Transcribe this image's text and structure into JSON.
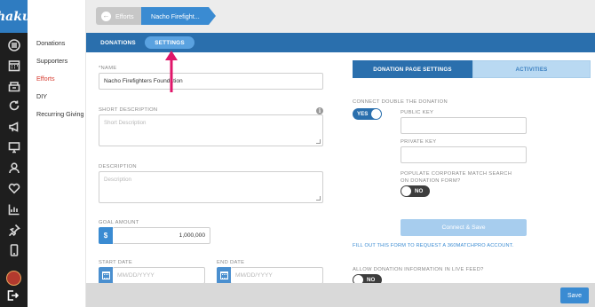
{
  "brand": {
    "logo_text": "haku"
  },
  "rail": {
    "icons": [
      "dashboard-icon",
      "calendar-icon",
      "inbox-icon",
      "refresh-icon",
      "megaphone-icon",
      "monitor-icon",
      "users-icon",
      "heart-icon",
      "bar-chart-icon",
      "pin-icon",
      "mobile-icon"
    ]
  },
  "subnav": {
    "items": [
      {
        "label": "Donations",
        "active": false
      },
      {
        "label": "Supporters",
        "active": false
      },
      {
        "label": "Efforts",
        "active": true
      },
      {
        "label": "DIY",
        "active": false
      },
      {
        "label": "Recurring Giving",
        "active": false
      }
    ]
  },
  "breadcrumb": {
    "back_label": "Efforts",
    "current_label": "Nacho Firefight..."
  },
  "tabs": {
    "donations": "DONATIONS",
    "settings": "SETTINGS"
  },
  "form": {
    "name_label": "*NAME",
    "name_value": "Nacho Firefighters Foundation",
    "short_desc_label": "SHORT DESCRIPTION",
    "short_desc_placeholder": "Short Description",
    "desc_label": "DESCRIPTION",
    "desc_placeholder": "Description",
    "goal_label": "GOAL AMOUNT",
    "goal_prefix": "$",
    "goal_value": "1,000,000",
    "start_label": "START DATE",
    "start_placeholder": "MM/DD/YYYY",
    "end_label": "END DATE",
    "end_placeholder": "MM/DD/YYYY"
  },
  "right": {
    "tab_page_settings": "DONATION PAGE SETTINGS",
    "tab_activities": "ACTIVITIES",
    "connect_label": "CONNECT DOUBLE THE DONATION",
    "connect_toggle": "YES",
    "public_key_label": "PUBLIC KEY",
    "private_key_label": "PRIVATE KEY",
    "populate_label_1": "POPULATE CORPORATE MATCH SEARCH",
    "populate_label_2": "ON DONATION FORM?",
    "populate_toggle": "NO",
    "connect_save": "Connect & Save",
    "request_link": "FILL OUT THIS FORM TO REQUEST A 360MATCHPRO ACCOUNT.",
    "live_feed_label": "ALLOW DONATION INFORMATION IN LIVE FEED?",
    "live_feed_toggle": "NO"
  },
  "footer": {
    "save_label": "Save"
  },
  "colors": {
    "primary": "#2a6fad",
    "accent": "#3a8bd2",
    "active_nav": "#d63b2f",
    "annotation": "#e0166a"
  }
}
